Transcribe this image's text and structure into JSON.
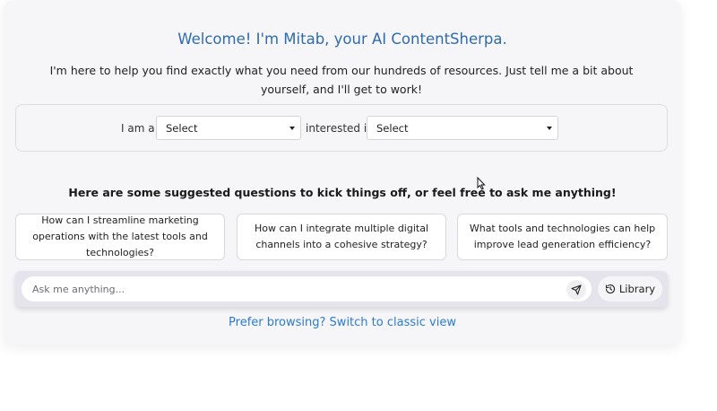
{
  "header": {
    "title": "Welcome! I'm Mitab, your AI ContentSherpa.",
    "intro": "I'm here to help you find exactly what you need from our hundreds of resources. Just tell me a bit about yourself, and I'll get to work!"
  },
  "selector": {
    "role_label": "I am a",
    "role_value": "Select",
    "interest_label": "interested in",
    "interest_value": "Select"
  },
  "suggestions": {
    "heading": "Here are some suggested questions to kick things off, or feel free to ask me anything!",
    "items": [
      "How can I streamline marketing operations with the latest tools and technologies?",
      "How can I integrate multiple digital channels into a cohesive strategy?",
      "What tools and technologies can help improve lead generation efficiency?"
    ]
  },
  "chat": {
    "placeholder": "Ask me anything...",
    "send_icon": "send-icon",
    "library_label": "Library",
    "library_icon": "history-icon"
  },
  "footer": {
    "classic_link": "Prefer browsing? Switch to classic view"
  },
  "colors": {
    "title": "#2f6cad",
    "link": "#2a7bd1",
    "card_bg": "#f6f5f8"
  }
}
